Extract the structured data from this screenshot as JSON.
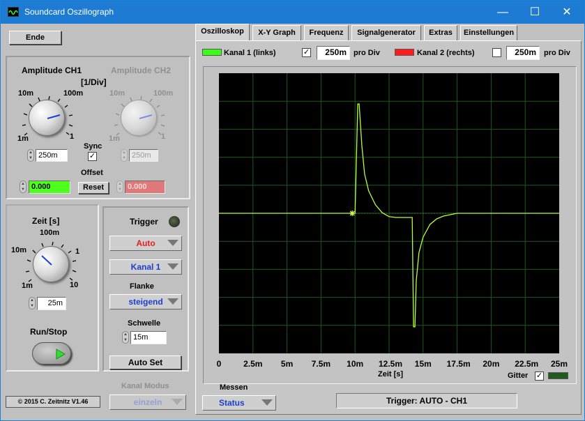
{
  "window": {
    "title": "Soundcard Oszillograph",
    "minimize": "—",
    "maximize": "☐",
    "close": "✕"
  },
  "left": {
    "ende_label": "Ende",
    "amplitude": {
      "ch1_label": "Amplitude CH1",
      "ch2_label": "Amplitude CH2",
      "unit": "[1/Div]",
      "ch1_scale": {
        "s10m": "10m",
        "s100m": "100m",
        "s1m": "1m",
        "s1": "1"
      },
      "ch2_scale": {
        "s10m": "10m",
        "s100m": "100m",
        "s1m": "1m",
        "s1": "1"
      },
      "ch1_value": "250m",
      "ch2_value": "250m",
      "sync_label": "Sync",
      "sync_checked": "✓",
      "offset_label": "Offset",
      "ch1_offset": "0.000",
      "ch2_offset": "0.000",
      "reset_label": "Reset"
    },
    "zeit": {
      "label": "Zeit [s]",
      "scale": {
        "s100m": "100m",
        "s10m": "10m",
        "s1": "1",
        "s1m": "1m",
        "s10": "10"
      },
      "value": "25m"
    },
    "runstop_label": "Run/Stop",
    "trigger": {
      "label": "Trigger",
      "mode": "Auto",
      "channel": "Kanal 1",
      "flanke_label": "Flanke",
      "flanke": "steigend",
      "schwelle_label": "Schwelle",
      "schwelle": "15m",
      "autoset_label": "Auto Set"
    },
    "kanal_modus_label": "Kanal Modus",
    "kanal_modus": "einzeln",
    "copyright": "© 2015   C. Zeitnitz V1.46"
  },
  "tabs": [
    "Oszilloskop",
    "X-Y Graph",
    "Frequenz",
    "Signalgenerator",
    "Extras",
    "Einstellungen"
  ],
  "channels": {
    "ch1_label": "Kanal 1 (links)",
    "ch1_checked": "✓",
    "ch1_value": "250m",
    "pro_div": "pro Div",
    "ch2_label": "Kanal 2 (rechts)",
    "ch2_value": "250m",
    "ch1_color": "#39ff14",
    "ch2_color": "#ff1a1a"
  },
  "plot": {
    "xlabel": "Zeit [s]",
    "xticks": [
      "0",
      "2.5m",
      "5m",
      "7.5m",
      "10m",
      "12.5m",
      "15m",
      "17.5m",
      "20m",
      "22.5m",
      "25m"
    ],
    "gitter_label": "Gitter",
    "gitter_checked": "✓"
  },
  "bottom": {
    "messen_label": "Messen",
    "messen_value": "Status",
    "trigger_status": "Trigger: AUTO - CH1"
  },
  "chart_data": {
    "type": "line",
    "xlim": [
      0,
      0.025
    ],
    "ylim": [
      -5,
      5
    ],
    "grid": true,
    "series": [
      {
        "color": "#b6ff3a",
        "x": [
          0,
          0.01,
          0.0102,
          0.0103,
          0.0105,
          0.0107,
          0.011,
          0.0115,
          0.012,
          0.0125,
          0.013,
          0.0135,
          0.0142,
          0.0143,
          0.0144,
          0.0145,
          0.0147,
          0.015,
          0.0155,
          0.016,
          0.0165,
          0.017,
          0.0175,
          0.018,
          0.025
        ],
        "y": [
          0,
          0,
          3.9,
          3.9,
          2.4,
          1.4,
          0.8,
          0.3,
          0.02,
          -0.12,
          -0.15,
          -0.15,
          -0.15,
          -4.05,
          -4.05,
          -2.4,
          -1.4,
          -0.85,
          -0.4,
          -0.2,
          -0.1,
          -0.05,
          0,
          0,
          0
        ]
      }
    ]
  }
}
